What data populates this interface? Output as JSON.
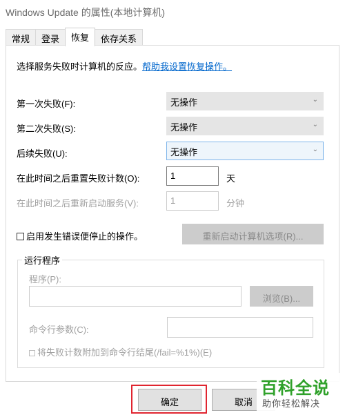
{
  "window": {
    "title": "Windows Update 的属性(本地计算机)"
  },
  "tabs": [
    {
      "label": "常规",
      "active": false
    },
    {
      "label": "登录",
      "active": false
    },
    {
      "label": "恢复",
      "active": true
    },
    {
      "label": "依存关系",
      "active": false
    }
  ],
  "recovery": {
    "intro_text": "选择服务失败时计算机的反应。",
    "help_link": "帮助我设置恢复操作。",
    "first_failure": {
      "label": "第一次失败(F):",
      "value": "无操作"
    },
    "second_failure": {
      "label": "第二次失败(S):",
      "value": "无操作"
    },
    "subsequent_failures": {
      "label": "后续失败(U):",
      "value": "无操作"
    },
    "reset_count": {
      "label": "在此时间之后重置失败计数(O):",
      "value": "1",
      "unit": "天"
    },
    "restart_service": {
      "label": "在此时间之后重新启动服务(V):",
      "value": "1",
      "unit": "分钟"
    },
    "enable_stop_actions": {
      "label": "启用发生错误便停止的操作。",
      "checked": false
    },
    "restart_computer_options_button": "重新启动计算机选项(R)...",
    "run_program": {
      "group_title": "运行程序",
      "program_label": "程序(P):",
      "program_value": "",
      "browse_button": "浏览(B)...",
      "params_label": "命令行参数(C):",
      "params_value": "",
      "append_fail_count": {
        "label": "将失败计数附加到命令行结尾(/fail=%1%)(E)",
        "checked": false
      }
    }
  },
  "footer": {
    "ok_label": "确定",
    "cancel_label": "取消"
  },
  "watermark": {
    "main": "百科全说",
    "sub": "助你轻松解决"
  },
  "colors": {
    "link": "#0066cc",
    "highlight_border": "#e0242f",
    "watermark_green": "#2fa12a"
  }
}
